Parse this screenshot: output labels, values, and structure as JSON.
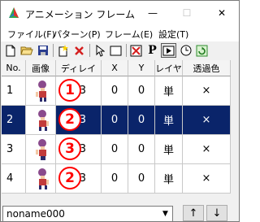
{
  "window": {
    "title": "アニメーション フレーム",
    "minimize_glyph": "—",
    "maximize_glyph": "☐",
    "close_glyph": "✕"
  },
  "menu": [
    {
      "label": "ファイル(F)"
    },
    {
      "label": "パターン(P)"
    },
    {
      "label": "フレーム(E)"
    },
    {
      "label": "設定(T)"
    }
  ],
  "toolbar": {
    "icons": [
      "new-file-icon",
      "open-folder-icon",
      "save-icon",
      "new-frame-icon",
      "delete-icon",
      "pointer-icon",
      "rectangle-select-icon",
      "toggle-x-icon",
      "text-p-icon",
      "play-icon",
      "timer-clock-icon",
      "refresh-icon"
    ],
    "p_label": "P"
  },
  "table": {
    "columns": [
      "No.",
      "画像",
      "ディレイ",
      "X",
      "Y",
      "レイヤ",
      "透過色"
    ],
    "rows": [
      {
        "no": "1",
        "delay": "3",
        "x": "0",
        "y": "0",
        "layer": "単",
        "transparent": "×",
        "badge": "1",
        "selected": false
      },
      {
        "no": "2",
        "delay": "3",
        "x": "0",
        "y": "0",
        "layer": "単",
        "transparent": "×",
        "badge": "2",
        "selected": true
      },
      {
        "no": "3",
        "delay": "3",
        "x": "0",
        "y": "0",
        "layer": "単",
        "transparent": "×",
        "badge": "3",
        "selected": false
      },
      {
        "no": "4",
        "delay": "3",
        "x": "0",
        "y": "0",
        "layer": "単",
        "transparent": "×",
        "badge": "2",
        "selected": false
      }
    ]
  },
  "bottom": {
    "name_value": "noname000",
    "up_label": "↑",
    "down_label": "↓"
  },
  "colors": {
    "selection": "#0a246a",
    "badge": "#ff0000"
  }
}
